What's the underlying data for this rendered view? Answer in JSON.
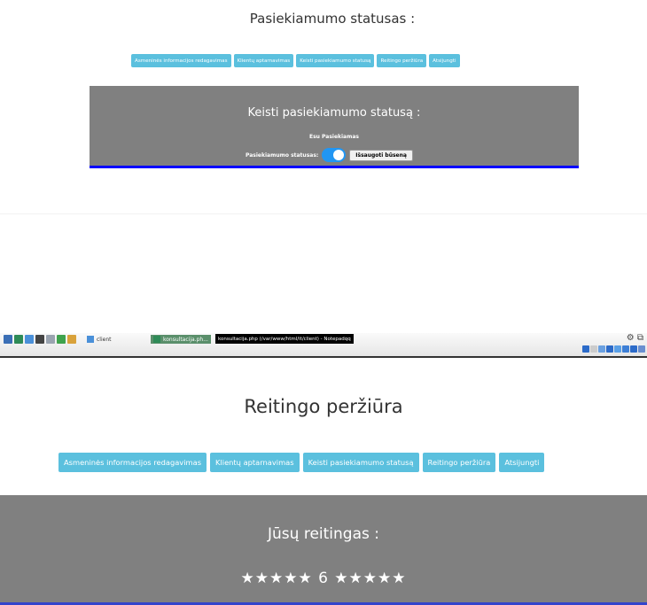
{
  "top_screen": {
    "page_title": "Pasiekiamumo statusas :",
    "nav": [
      "Asmeninės informacijos redagavimas",
      "Klientų aptarnavimas",
      "Keisti pasiekiamumo statusą",
      "Reitingo peržiūra",
      "Atsijungti"
    ],
    "panel_title": "Keisti pasiekiamumo statusą :",
    "current_status": "Esu Pasiekiamas",
    "status_label": "Pasiekiamumo statusas:",
    "toggle_on": true,
    "save_button": "Išsaugoti būseną"
  },
  "taskbar": {
    "tasks": [
      {
        "label": "client",
        "icon": "folder-icon"
      },
      {
        "label": "konsultacija.ph...",
        "icon": "browser-icon"
      }
    ],
    "active_window": "konsultacija.php (/var/www/html/it/client) - Notepadqq"
  },
  "bottom_screen": {
    "page_title": "Reitingo peržiūra",
    "nav": [
      "Asmeninės informacijos redagavimas",
      "Klientų aptarnavimas",
      "Keisti pasiekiamumo statusą",
      "Reitingo peržiūra",
      "Atsijungti"
    ],
    "panel_title": "Jūsų reitingas :",
    "rating_display": "★★★★★ 6 ★★★★★"
  },
  "colors": {
    "nav_button": "#5bc0de",
    "panel": "#808080",
    "toggle": "#2196F3",
    "panel_border": "#0000ff"
  }
}
